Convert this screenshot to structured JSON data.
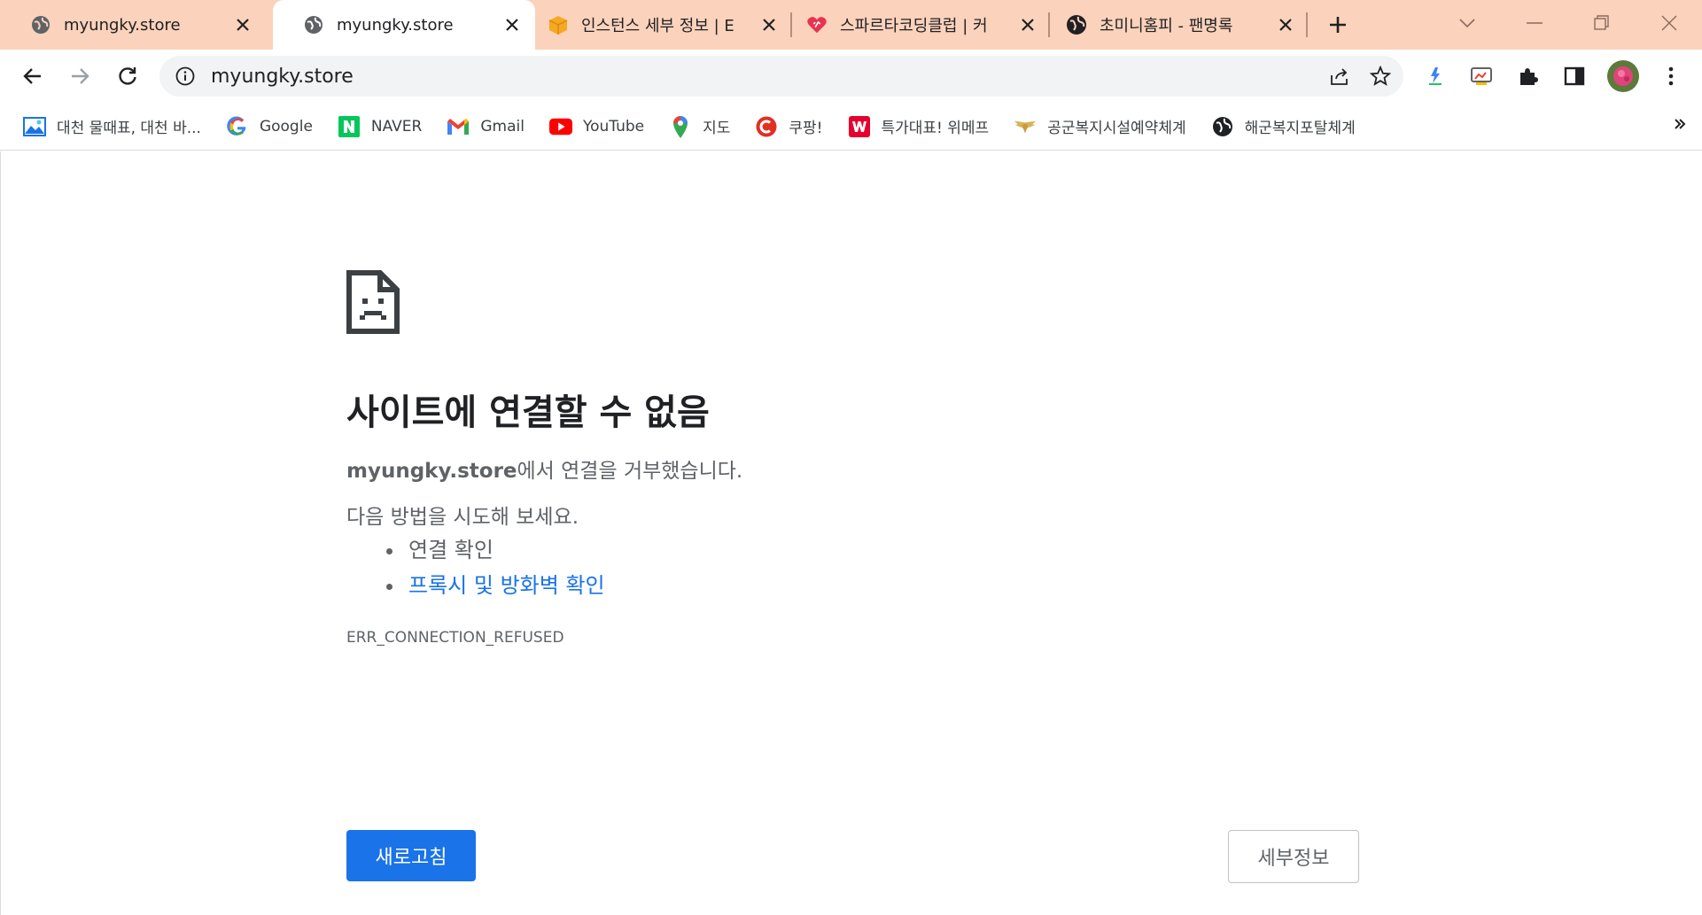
{
  "tabs": [
    {
      "title": "myungky.store",
      "active": false,
      "icon": "globe-icon"
    },
    {
      "title": "myungky.store",
      "active": true,
      "icon": "globe-icon"
    },
    {
      "title": "인스턴스 세부 정보 | E",
      "active": false,
      "icon": "aws-box-icon"
    },
    {
      "title": "스파르타코딩클럽 | 커",
      "active": false,
      "icon": "sparta-heart-icon"
    },
    {
      "title": "초미니홈피 - 팬명록",
      "active": false,
      "icon": "globe-icon"
    }
  ],
  "toolbar": {
    "url": "myungky.store"
  },
  "bookmarks": [
    {
      "label": "대천 물때표, 대천 바...",
      "icon": "image-icon"
    },
    {
      "label": "Google",
      "icon": "google-icon"
    },
    {
      "label": "NAVER",
      "icon": "naver-icon"
    },
    {
      "label": "Gmail",
      "icon": "gmail-icon"
    },
    {
      "label": "YouTube",
      "icon": "youtube-icon"
    },
    {
      "label": "지도",
      "icon": "maps-pin-icon"
    },
    {
      "label": "쿠팡!",
      "icon": "coupang-icon"
    },
    {
      "label": "특가대표! 위메프",
      "icon": "wemakeprice-icon"
    },
    {
      "label": "공군복지시설예약체계",
      "icon": "airforce-wing-icon"
    },
    {
      "label": "해군복지포탈체계",
      "icon": "globe-icon"
    }
  ],
  "error_page": {
    "title": "사이트에 연결할 수 없음",
    "host": "myungky.store",
    "desc_suffix": "에서 연결을 거부했습니다.",
    "try_text": "다음 방법을 시도해 보세요.",
    "suggestions": [
      {
        "text": "연결 확인",
        "link": false
      },
      {
        "text": "프록시 및 방화벽 확인",
        "link": true
      }
    ],
    "error_code": "ERR_CONNECTION_REFUSED",
    "reload_label": "새로고침",
    "details_label": "세부정보"
  },
  "colors": {
    "tab_strip_bg": "#fbd2bb",
    "primary_blue": "#1a73e8",
    "text_secondary": "#5f6368"
  }
}
